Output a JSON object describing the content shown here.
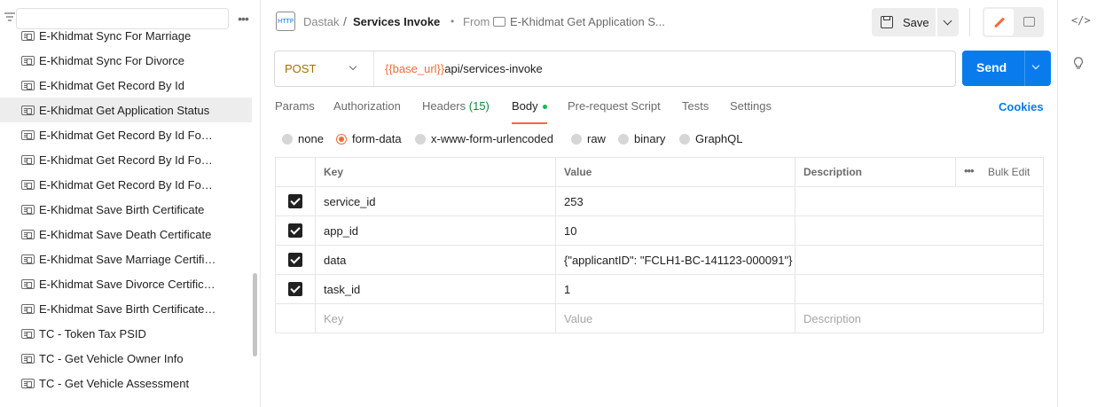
{
  "sidebar": {
    "items": [
      {
        "label": "E-Khidmat Sync For Marriage"
      },
      {
        "label": "E-Khidmat Sync For Divorce"
      },
      {
        "label": "E-Khidmat Get Record By Id"
      },
      {
        "label": "E-Khidmat Get Application Status",
        "active": true
      },
      {
        "label": "E-Khidmat Get Record By Id For ..."
      },
      {
        "label": "E-Khidmat Get Record By Id For ..."
      },
      {
        "label": "E-Khidmat Get Record By Id For ..."
      },
      {
        "label": "E-Khidmat Save Birth Certificate"
      },
      {
        "label": "E-Khidmat Save Death Certificate"
      },
      {
        "label": "E-Khidmat Save Marriage Certific..."
      },
      {
        "label": "E-Khidmat Save Divorce Certificate"
      },
      {
        "label": "E-Khidmat Save Birth Certificate ..."
      },
      {
        "label": "TC - Token Tax PSID"
      },
      {
        "label": "TC - Get Vehicle Owner Info"
      },
      {
        "label": "TC - Get Vehicle Assessment"
      }
    ]
  },
  "header": {
    "http_icon_text": "HTTP",
    "breadcrumb_parent": "Dastak",
    "breadcrumb_sep": "/",
    "title": "Services Invoke",
    "from_bullet": "•",
    "from_label": "From",
    "from_name": "E-Khidmat Get Application S...",
    "save_label": "Save"
  },
  "request": {
    "method": "POST",
    "url_variable": "{{base_url}}",
    "url_path": "api/services-invoke",
    "send_label": "Send"
  },
  "tabs": {
    "params": "Params",
    "authorization": "Authorization",
    "headers": "Headers",
    "headers_count": "(15)",
    "body": "Body",
    "prerequest": "Pre-request Script",
    "tests": "Tests",
    "settings": "Settings",
    "cookies": "Cookies"
  },
  "body_types": {
    "none": "none",
    "form_data": "form-data",
    "urlencoded": "x-www-form-urlencoded",
    "raw": "raw",
    "binary": "binary",
    "graphql": "GraphQL",
    "selected": "form-data"
  },
  "table": {
    "headers": {
      "key": "Key",
      "value": "Value",
      "description": "Description",
      "bulk_edit": "Bulk Edit"
    },
    "rows": [
      {
        "key": "service_id",
        "value": "253",
        "description": "",
        "checked": true
      },
      {
        "key": "app_id",
        "value": "10",
        "description": "",
        "checked": true
      },
      {
        "key": "data",
        "value": "{\"applicantID\": \"FCLH1-BC-141123-000091\"}",
        "description": "",
        "checked": true
      },
      {
        "key": "task_id",
        "value": "1",
        "description": "",
        "checked": true
      }
    ],
    "placeholders": {
      "key": "Key",
      "value": "Value",
      "description": "Description"
    }
  },
  "colors": {
    "accent": "#f26b3a",
    "primary": "#097bed",
    "method": "#a66f00",
    "headers_count": "#0d8a3a"
  }
}
